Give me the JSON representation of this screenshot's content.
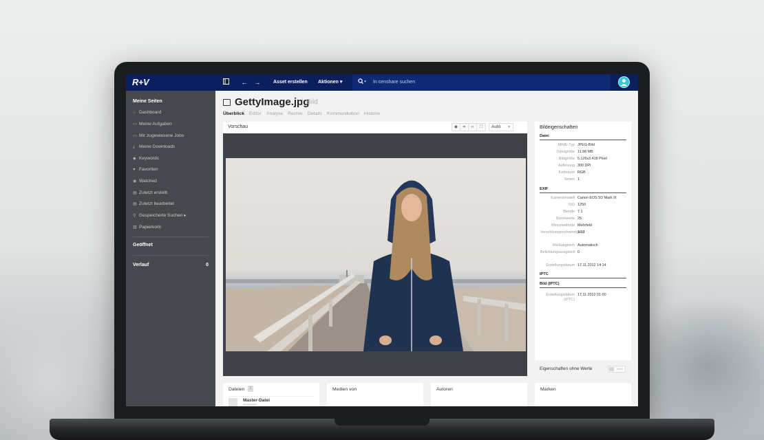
{
  "topbar": {
    "logo": "R+V",
    "panel_toggle_icon": "sidebar-toggle-icon",
    "back_icon": "arrow-left-icon",
    "forward_icon": "arrow-right-icon",
    "create_asset": "Asset erstellen",
    "actions": "Aktionen ▾",
    "search_placeholder": "In censhare suchen"
  },
  "sidebar": {
    "section_title": "Meine Seiten",
    "items": [
      {
        "label": "Dashboard",
        "icon": "home-icon"
      },
      {
        "label": "Meine Aufgaben",
        "icon": "inbox-icon"
      },
      {
        "label": "Mir zugewiesene Jobs",
        "icon": "inbox-icon"
      },
      {
        "label": "Meine Downloads",
        "icon": "download-icon"
      },
      {
        "label": "Keywords",
        "icon": "tag-icon"
      },
      {
        "label": "Favoriten",
        "icon": "heart-icon"
      },
      {
        "label": "Watched",
        "icon": "eye-icon"
      },
      {
        "label": "Zuletzt erstellt",
        "icon": "file-icon"
      },
      {
        "label": "Zuletzt bearbeitet",
        "icon": "file-icon"
      },
      {
        "label": "Gespeicherte Suchen ▸",
        "icon": "search-icon"
      },
      {
        "label": "Papierkorb",
        "icon": "trash-icon"
      }
    ],
    "opened_title": "Geöffnet",
    "history_title": "Verlauf",
    "history_count": "0"
  },
  "asset": {
    "title": "GettyImage.jpg",
    "type": "Bild",
    "tabs": [
      "Überblick",
      "Editor",
      "Analyse",
      "Rechte",
      "Details",
      "Kommunikation",
      "Historie"
    ],
    "active_tab": "Überblick"
  },
  "preview": {
    "label": "Vorschau",
    "zoom_value": "Auto"
  },
  "properties": {
    "title": "Bildeigenschaften",
    "sections": [
      {
        "name": "Datei",
        "rows": [
          {
            "k": "MIME-Typ",
            "v": "JPEG-Bild"
          },
          {
            "k": "Dateigröße",
            "v": "11,98 MB"
          },
          {
            "k": "Bildgröße",
            "v": "5.126x3.418 Pixel"
          },
          {
            "k": "Auflösung",
            "v": "300 DPI"
          },
          {
            "k": "Farbraum",
            "v": "RGB"
          },
          {
            "k": "Seiten",
            "v": "1"
          }
        ]
      },
      {
        "name": "EXIF",
        "rows": [
          {
            "k": "Kameramodell",
            "v": "Canon EOS 5D Mark III"
          },
          {
            "k": "ISO",
            "v": "1250"
          },
          {
            "k": "Blende",
            "v": "7.1"
          },
          {
            "k": "Brennweite",
            "v": "25"
          },
          {
            "k": "Messmethode",
            "v": "Mehrfeld"
          },
          {
            "k": "Verschlussgeschwindigkeit",
            "v": "1/13"
          },
          {
            "k": "Weißabgleich",
            "v": "Automatisch"
          },
          {
            "k": "Belichtungsausgleich",
            "v": "0"
          },
          {
            "k": "Erstellungsdatum",
            "v": "17.11.2012 14:14"
          }
        ]
      },
      {
        "name": "IPTC",
        "rows": []
      },
      {
        "name": "Bild (IPTC)",
        "rows": [
          {
            "k": "Erstellungsdatum (IPTC)",
            "v": "17.11.2012 01:00"
          }
        ]
      }
    ],
    "footer_label": "Eigenschaften ohne Werte",
    "footer_toggle": "AUS"
  },
  "cards": {
    "files": {
      "label": "Dateien",
      "count": "1",
      "master": "Master-Datei"
    },
    "media_of": {
      "label": "Medien von"
    },
    "authors": {
      "label": "Autoren"
    },
    "brands": {
      "label": "Marken"
    }
  }
}
